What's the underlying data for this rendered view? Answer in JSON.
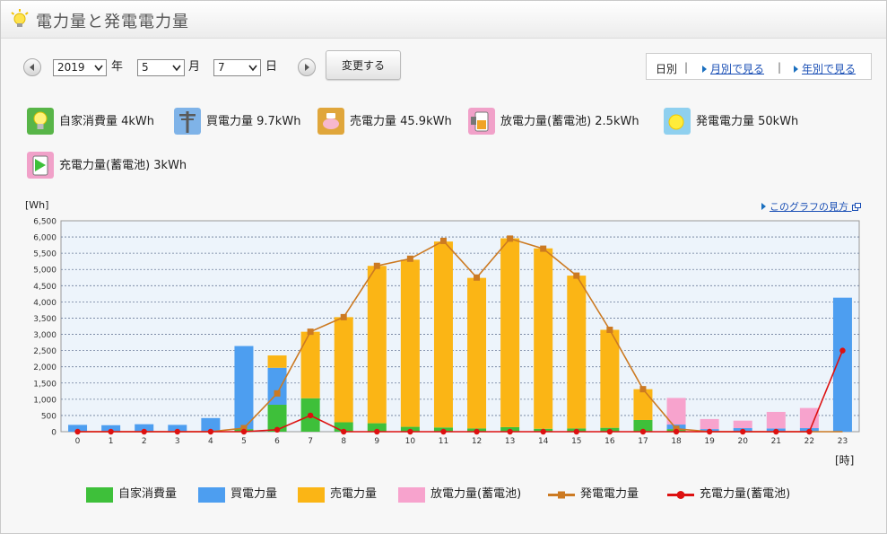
{
  "title": "電力量と発電電力量",
  "controls": {
    "year": "2019",
    "year_unit": "年",
    "month": "5",
    "month_unit": "月",
    "day": "7",
    "day_unit": "日",
    "change_label": "変更する"
  },
  "period": {
    "daily": "日別",
    "sep": "|",
    "monthly": "月別で見る",
    "yearly": "年別で見る"
  },
  "summaries": [
    {
      "label": "自家消費量 4kWh",
      "icon": "lightbulb-icon"
    },
    {
      "label": "買電力量 9.7kWh",
      "icon": "utility-pole-icon"
    },
    {
      "label": "売電力量 45.9kWh",
      "icon": "piggy-bank-icon"
    },
    {
      "label": "放電力量(蓄電池) 2.5kWh",
      "icon": "battery-discharge-icon"
    },
    {
      "label": "発電電力量 50kWh",
      "icon": "sun-icon"
    },
    {
      "label": "充電力量(蓄電池) 3kWh",
      "icon": "battery-charge-icon"
    }
  ],
  "chart": {
    "unit": "[Wh]",
    "x_unit": "[時]",
    "guide_link": "このグラフの見方"
  },
  "colors": {
    "self": "#3ec03a",
    "buy": "#4d9ef0",
    "sell": "#fbb515",
    "discharge": "#f7a3cd",
    "generation": "#cc7a22",
    "charge": "#dd1111"
  },
  "chart_data": {
    "type": "bar",
    "stacked": true,
    "categories": [
      "0",
      "1",
      "2",
      "3",
      "4",
      "5",
      "6",
      "7",
      "8",
      "9",
      "10",
      "11",
      "12",
      "13",
      "14",
      "15",
      "16",
      "17",
      "18",
      "19",
      "20",
      "21",
      "22",
      "23"
    ],
    "ylim": [
      0,
      6500
    ],
    "yticks": [
      "0",
      "500",
      "1,000",
      "1,500",
      "2,000",
      "2,500",
      "3,000",
      "3,500",
      "4,000",
      "4,500",
      "5,000",
      "5,500",
      "6,000",
      "6,500"
    ],
    "grid": true,
    "legend_position": "bottom",
    "series": [
      {
        "name": "自家消費量",
        "type": "bar",
        "values": [
          0,
          0,
          0,
          0,
          0,
          80,
          830,
          1030,
          290,
          260,
          150,
          130,
          100,
          140,
          90,
          100,
          120,
          360,
          80,
          0,
          0,
          0,
          0,
          0
        ]
      },
      {
        "name": "買電力量",
        "type": "bar",
        "values": [
          210,
          200,
          230,
          210,
          420,
          2560,
          1140,
          0,
          0,
          0,
          0,
          0,
          0,
          0,
          0,
          0,
          0,
          0,
          140,
          80,
          110,
          100,
          110,
          4130
        ]
      },
      {
        "name": "売電力量",
        "type": "bar",
        "values": [
          0,
          0,
          0,
          0,
          0,
          0,
          380,
          2050,
          3240,
          4850,
          5150,
          5730,
          4640,
          5820,
          5560,
          4710,
          3020,
          950,
          0,
          0,
          0,
          0,
          0,
          0
        ]
      },
      {
        "name": "放電力量(蓄電池)",
        "type": "bar",
        "values": [
          0,
          0,
          0,
          0,
          0,
          0,
          0,
          0,
          0,
          0,
          0,
          0,
          0,
          0,
          0,
          0,
          0,
          0,
          820,
          310,
          230,
          510,
          620,
          0
        ]
      },
      {
        "name": "発電電力量",
        "type": "line",
        "values": [
          0,
          0,
          0,
          0,
          0,
          110,
          1180,
          3080,
          3530,
          5110,
          5330,
          5880,
          4750,
          5950,
          5640,
          4810,
          3140,
          1310,
          90,
          0,
          0,
          0,
          0,
          0
        ]
      },
      {
        "name": "充電力量(蓄電池)",
        "type": "line",
        "values": [
          0,
          0,
          0,
          0,
          0,
          0,
          60,
          500,
          0,
          0,
          0,
          0,
          0,
          0,
          0,
          0,
          0,
          0,
          0,
          0,
          0,
          0,
          0,
          2500
        ]
      }
    ]
  }
}
